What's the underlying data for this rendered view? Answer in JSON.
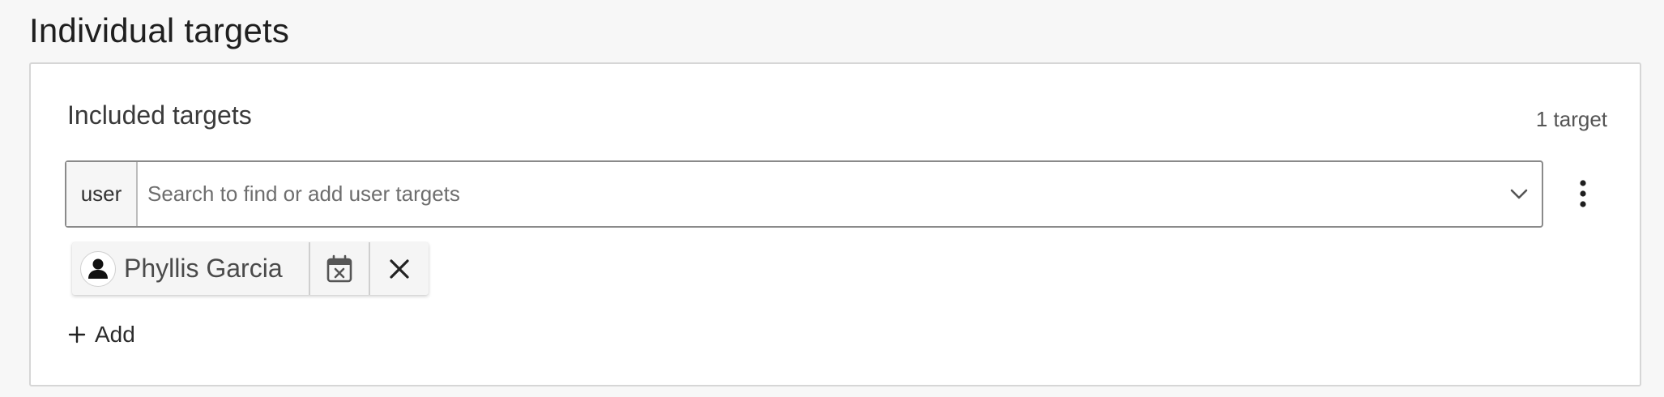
{
  "section": {
    "title": "Individual targets"
  },
  "card": {
    "title": "Included targets",
    "count_text": "1 target",
    "search": {
      "kind_label": "user",
      "placeholder": "Search to find or add user targets",
      "value": ""
    },
    "chips": [
      {
        "name": "Phyllis Garcia",
        "avatar_icon": "person-icon",
        "schedule_icon": "calendar-remove-icon",
        "remove_icon": "close-icon"
      }
    ],
    "add_label": "Add"
  },
  "icons": {
    "dropdown": "chevron-down-icon",
    "menu": "kebab-menu-icon",
    "add": "plus-icon"
  }
}
